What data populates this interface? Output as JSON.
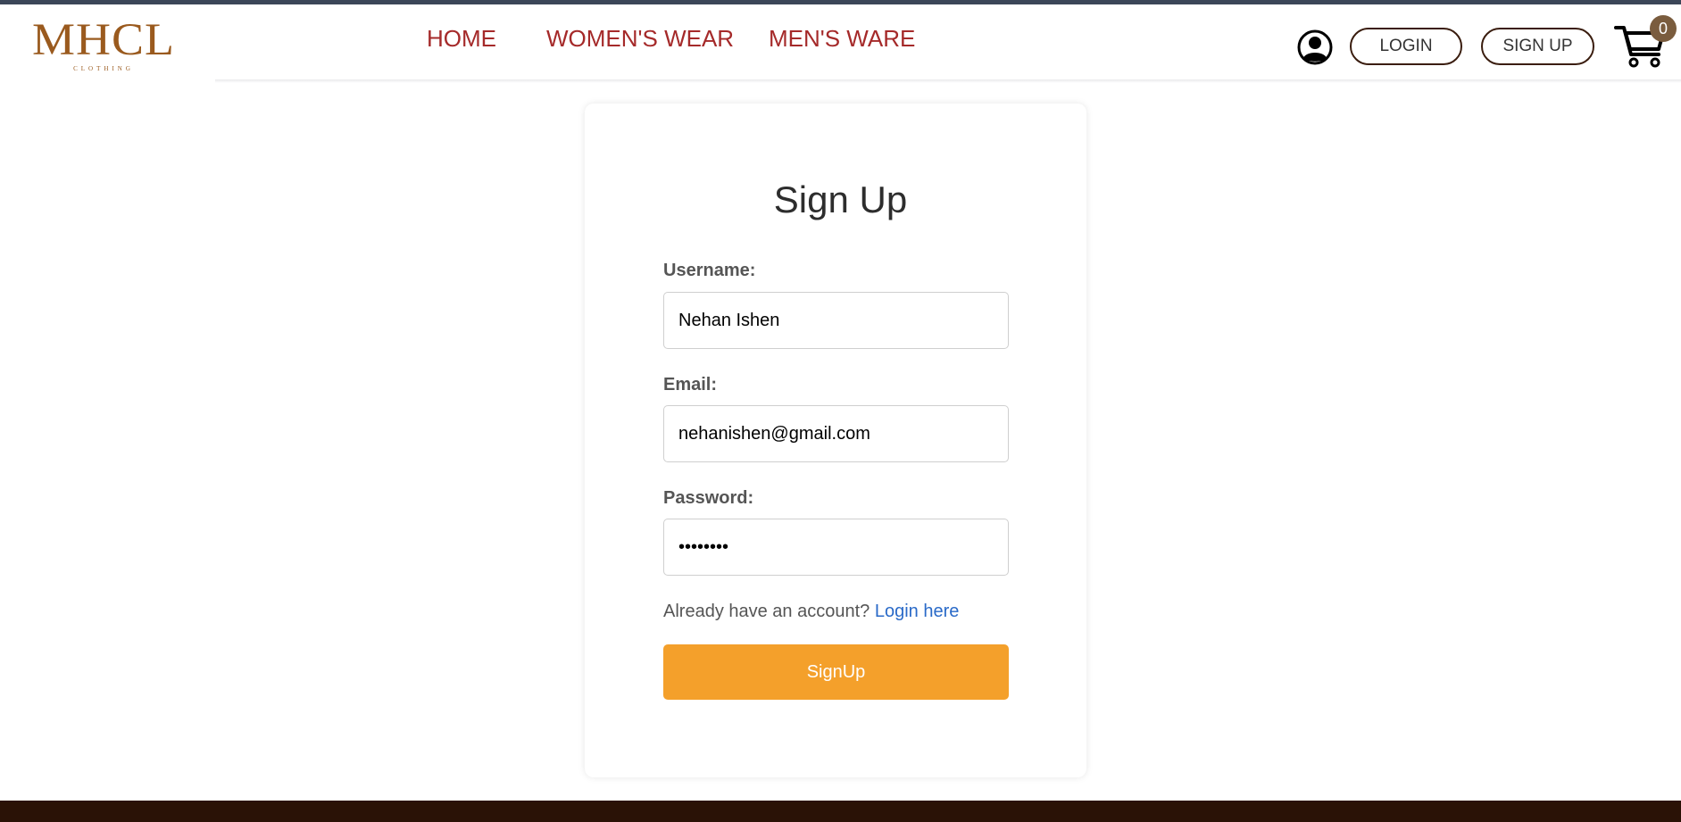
{
  "brand": {
    "logo_mark": "MHCL",
    "logo_sub": "CLOTHING"
  },
  "nav": {
    "home": "HOME",
    "women": "WOMEN'S WEAR",
    "men": "MEN'S WARE"
  },
  "header_actions": {
    "login_label": "LOGIN",
    "signup_label": "SIGN UP",
    "cart_count": "0"
  },
  "form": {
    "title": "Sign Up",
    "username_label": "Username:",
    "username_value": "Nehan Ishen",
    "email_label": "Email:",
    "email_value": "nehanishen@gmail.com",
    "password_label": "Password:",
    "password_value": "••••••••",
    "account_prompt": "Already have an account?",
    "login_link": "Login here",
    "submit_label": "SignUp"
  },
  "colors": {
    "nav_link": "#a52a2a",
    "accent_button": "#f4a02b",
    "header_strip": "#3b4658",
    "footer": "#2a1206",
    "logo": "#9a5a1e",
    "link": "#2a6ac8"
  }
}
